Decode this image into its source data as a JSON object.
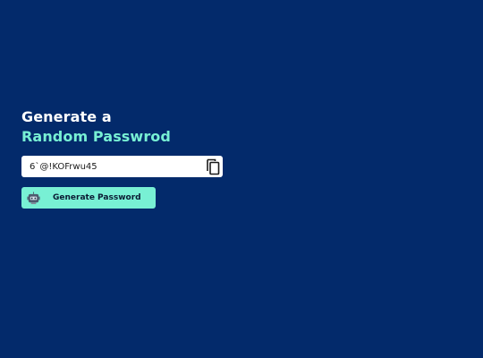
{
  "heading": {
    "line1": "Generate a",
    "line2": "Random Passwrod"
  },
  "password": {
    "value": "6`@!KOFrwu45"
  },
  "actions": {
    "copy_icon": "copy-icon",
    "generate_label": "Generate Password",
    "generate_icon": "robot-icon"
  },
  "colors": {
    "background": "#032a6b",
    "accent": "#78f0d4",
    "text_light": "#ffffff",
    "input_bg": "#ffffff"
  }
}
